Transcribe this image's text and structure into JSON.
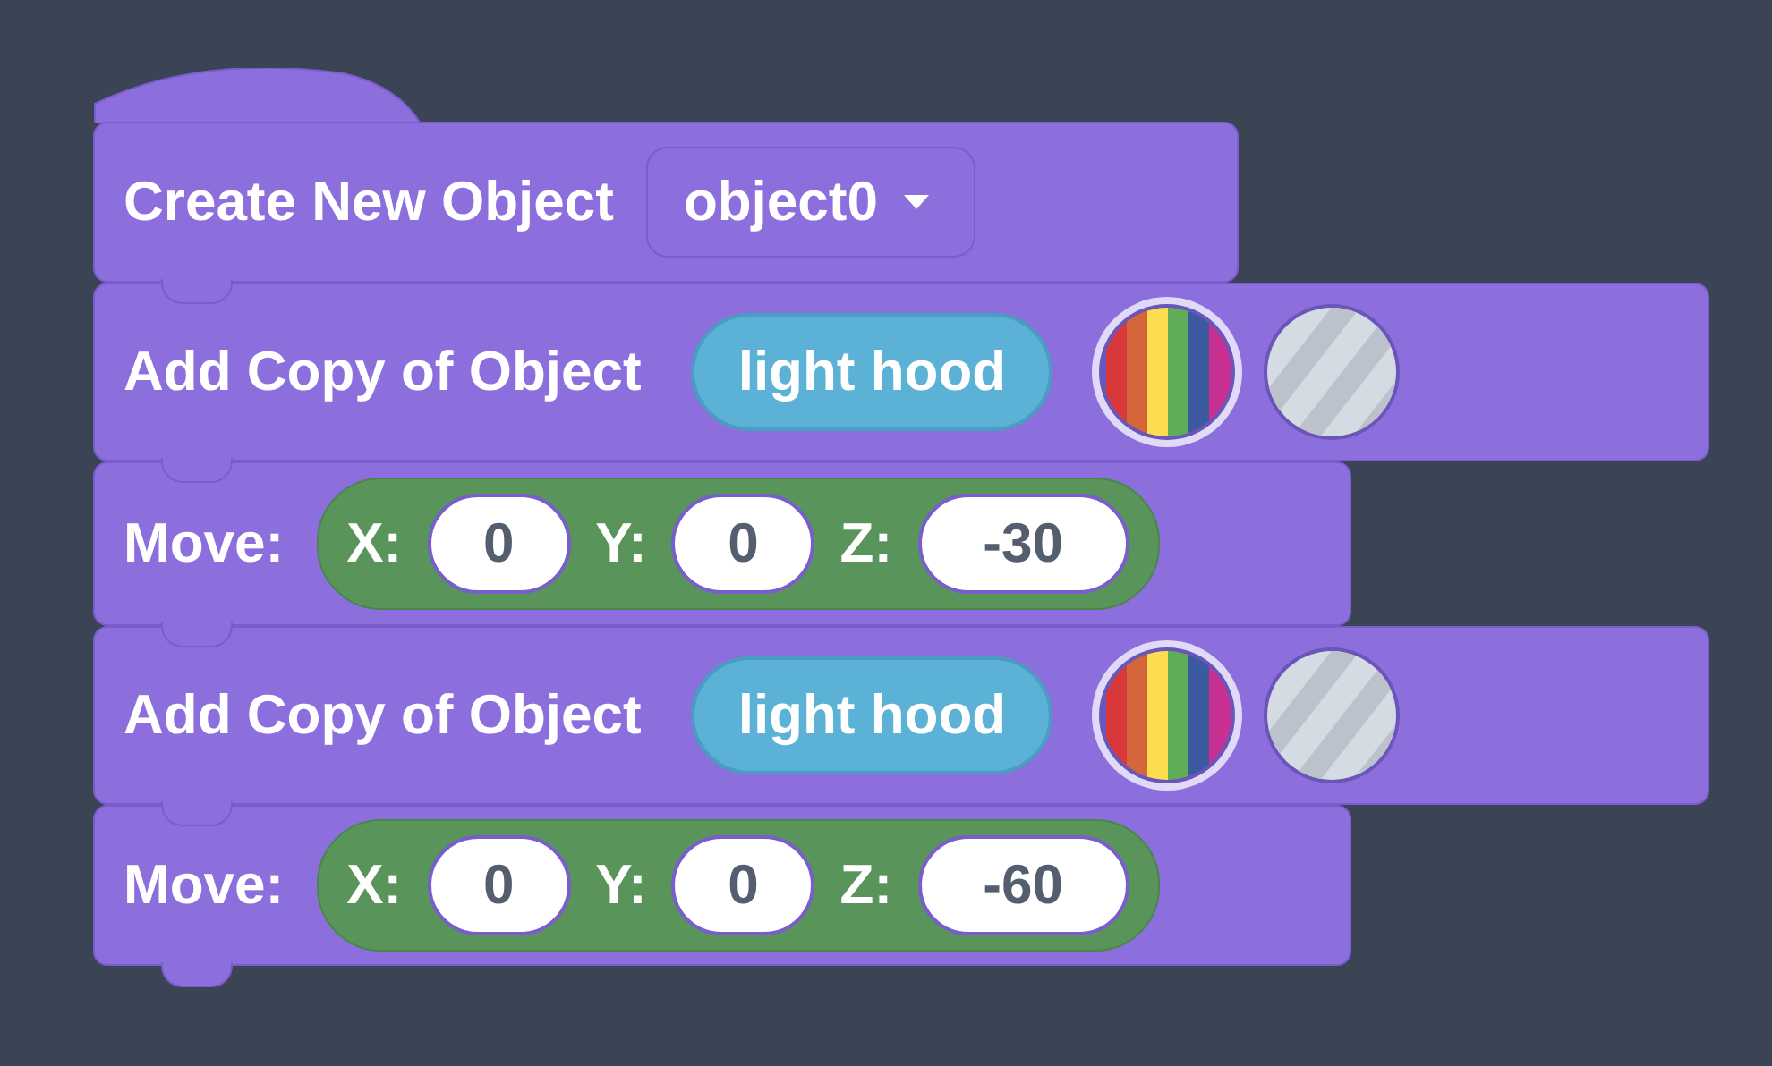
{
  "blocks": [
    {
      "kind": "create",
      "label": "Create New Object",
      "dropdown": "object0"
    },
    {
      "kind": "add_copy",
      "label": "Add Copy of Object",
      "object": "light hood",
      "materials": [
        {
          "kind": "rainbow",
          "selected": true
        },
        {
          "kind": "metal",
          "selected": false
        }
      ]
    },
    {
      "kind": "move",
      "label": "Move:",
      "axes": [
        {
          "label": "X:",
          "value": "0"
        },
        {
          "label": "Y:",
          "value": "0"
        },
        {
          "label": "Z:",
          "value": "-30"
        }
      ]
    },
    {
      "kind": "add_copy",
      "label": "Add Copy of Object",
      "object": "light hood",
      "materials": [
        {
          "kind": "rainbow",
          "selected": true
        },
        {
          "kind": "metal",
          "selected": false
        }
      ]
    },
    {
      "kind": "move",
      "label": "Move:",
      "axes": [
        {
          "label": "X:",
          "value": "0"
        },
        {
          "label": "Y:",
          "value": "0"
        },
        {
          "label": "Z:",
          "value": "-60"
        }
      ]
    }
  ]
}
